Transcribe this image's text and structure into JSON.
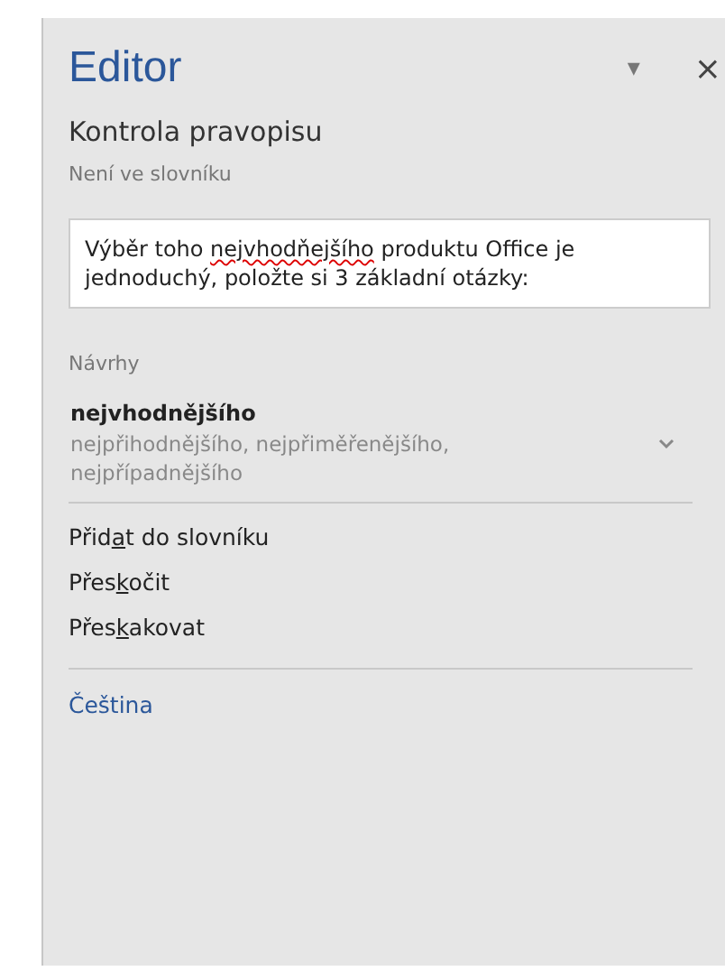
{
  "pane": {
    "title": "Editor",
    "menu_icon": "▾",
    "close": "×"
  },
  "section": {
    "title": "Kontrola pravopisu",
    "issue_type": "Není ve slovníku"
  },
  "context": {
    "before": "Výběr toho ",
    "misspelled": "nejvhodňejšího",
    "after": " produktu Office je jednoduchý, položte si 3 základní otázky:"
  },
  "suggestions": {
    "heading": "Návrhy",
    "primary": "nejvhodnějšího",
    "alternatives": "nejpřihodnějšího, nejpřiměřenějšího, nejpřípadnějšího",
    "expanded": false
  },
  "actions": [
    {
      "before": "Přid",
      "key": "a",
      "after": "t do slovníku"
    },
    {
      "before": "Přes",
      "key": "k",
      "after": "očit"
    },
    {
      "before": "Přes",
      "key": "k",
      "after": "akovat"
    }
  ],
  "language": "Čeština"
}
